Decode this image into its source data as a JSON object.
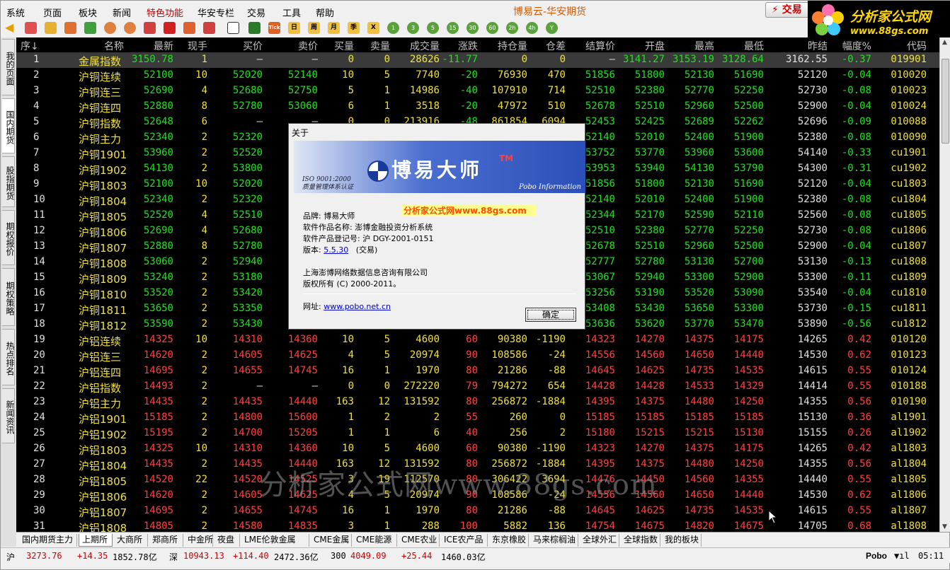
{
  "menu": [
    "系统",
    "页面",
    "板块",
    "新闻",
    "特色功能",
    "华安专栏",
    "交易",
    "工具",
    "帮助"
  ],
  "menu_highlight_index": 4,
  "title": "博易云-华安期货",
  "trade_button": "交易",
  "logo": {
    "name": "分析家公式网",
    "url": "www.88gs.com"
  },
  "toolbar_letters": [
    "日",
    "周",
    "月",
    "季",
    "X"
  ],
  "toolbar_circles": [
    "1",
    "3",
    "5",
    "15",
    "30",
    "60",
    "2h",
    "4h",
    "Y"
  ],
  "toolbar_tick": "Tick",
  "sidebar_tabs": [
    "我的页面",
    "国内期货",
    "股指期货",
    "期权报价",
    "期权策略",
    "热点排名",
    "新闻资讯"
  ],
  "sidebar_active": 1,
  "columns": [
    "序↓",
    "名称",
    "最新",
    "现手",
    "买价",
    "卖价",
    "买量",
    "卖量",
    "成交量",
    "涨跌",
    "持仓量",
    "仓差",
    "结算价",
    "开盘",
    "最高",
    "最低",
    "昨结",
    "幅度%",
    "代码"
  ],
  "rows": [
    [
      "1",
      "金属指数",
      "3150.78",
      "1",
      "—",
      "—",
      "0",
      "0",
      "28626",
      "-11.77",
      "0",
      "0",
      "—",
      "3141.27",
      "3153.19",
      "3128.64",
      "3162.55",
      "-0.37",
      "019901"
    ],
    [
      "2",
      "沪铜连续",
      "52100",
      "10",
      "52020",
      "52140",
      "10",
      "5",
      "7740",
      "-20",
      "76930",
      "470",
      "51856",
      "51800",
      "52130",
      "51690",
      "52120",
      "-0.04",
      "010020"
    ],
    [
      "3",
      "沪铜连三",
      "52690",
      "4",
      "52680",
      "52750",
      "5",
      "1",
      "14986",
      "-40",
      "107910",
      "714",
      "52510",
      "52380",
      "52770",
      "52250",
      "52730",
      "-0.08",
      "010023"
    ],
    [
      "4",
      "沪铜连四",
      "52880",
      "8",
      "52780",
      "53060",
      "6",
      "1",
      "3518",
      "-20",
      "47972",
      "510",
      "52678",
      "52510",
      "52960",
      "52500",
      "52900",
      "-0.04",
      "010024"
    ],
    [
      "5",
      "沪铜指数",
      "52648",
      "6",
      "—",
      "—",
      "0",
      "0",
      "213916",
      "-48",
      "861854",
      "6094",
      "52453",
      "52425",
      "52689",
      "52262",
      "52696",
      "-0.09",
      "010088"
    ],
    [
      "6",
      "沪铜主力",
      "52340",
      "2",
      "52320",
      "52340",
      "",
      "",
      "",
      "",
      "",
      "",
      "52140",
      "52010",
      "52400",
      "51900",
      "52380",
      "-0.08",
      "010090"
    ],
    [
      "7",
      "沪铜1901",
      "53960",
      "2",
      "52520",
      "",
      "",
      "",
      "",
      "",
      "",
      "",
      "53752",
      "53770",
      "53960",
      "53600",
      "54140",
      "-0.33",
      "cu1901"
    ],
    [
      "8",
      "沪铜1902",
      "54130",
      "2",
      "53800",
      "",
      "",
      "",
      "",
      "",
      "",
      "",
      "53953",
      "53940",
      "54130",
      "53790",
      "54300",
      "-0.31",
      "cu1902"
    ],
    [
      "9",
      "沪铜1803",
      "52100",
      "10",
      "52020",
      "",
      "",
      "",
      "",
      "",
      "",
      "",
      "51856",
      "51800",
      "52130",
      "51690",
      "52120",
      "-0.04",
      "cu1803"
    ],
    [
      "10",
      "沪铜1804",
      "52340",
      "2",
      "52320",
      "",
      "",
      "",
      "",
      "",
      "",
      "",
      "52140",
      "52010",
      "52400",
      "51900",
      "52380",
      "-0.08",
      "cu1804"
    ],
    [
      "11",
      "沪铜1805",
      "52520",
      "4",
      "52510",
      "",
      "",
      "",
      "",
      "",
      "",
      "",
      "52344",
      "52170",
      "52590",
      "52110",
      "52560",
      "-0.08",
      "cu1805"
    ],
    [
      "12",
      "沪铜1806",
      "52690",
      "4",
      "52680",
      "",
      "",
      "",
      "",
      "",
      "",
      "",
      "52510",
      "52380",
      "52770",
      "52250",
      "52730",
      "-0.08",
      "cu1806"
    ],
    [
      "13",
      "沪铜1807",
      "52880",
      "8",
      "52780",
      "",
      "",
      "",
      "",
      "",
      "",
      "",
      "52678",
      "52510",
      "52960",
      "52500",
      "52900",
      "-0.04",
      "cu1807"
    ],
    [
      "14",
      "沪铜1808",
      "53060",
      "2",
      "52940",
      "",
      "",
      "",
      "",
      "",
      "",
      "",
      "52777",
      "52780",
      "53130",
      "52700",
      "53130",
      "-0.13",
      "cu1808"
    ],
    [
      "15",
      "沪铜1809",
      "53240",
      "2",
      "53180",
      "",
      "",
      "",
      "",
      "",
      "",
      "",
      "53067",
      "52940",
      "53300",
      "52900",
      "53300",
      "-0.11",
      "cu1809"
    ],
    [
      "16",
      "沪铜1810",
      "53520",
      "2",
      "53420",
      "",
      "",
      "",
      "",
      "",
      "",
      "",
      "53256",
      "53190",
      "53520",
      "53090",
      "53540",
      "-0.04",
      "cu1810"
    ],
    [
      "17",
      "沪铜1811",
      "53650",
      "2",
      "53350",
      "",
      "",
      "",
      "",
      "",
      "",
      "",
      "53408",
      "53430",
      "53650",
      "53300",
      "53730",
      "-0.15",
      "cu1811"
    ],
    [
      "18",
      "沪铜1812",
      "53590",
      "2",
      "53430",
      "",
      "",
      "",
      "",
      "",
      "",
      "",
      "53636",
      "53620",
      "53770",
      "53470",
      "53890",
      "-0.56",
      "cu1812"
    ],
    [
      "19",
      "沪铝连续",
      "14325",
      "10",
      "14310",
      "14360",
      "10",
      "5",
      "4600",
      "60",
      "90380",
      "-1190",
      "14323",
      "14270",
      "14375",
      "14175",
      "14265",
      "0.42",
      "010120"
    ],
    [
      "20",
      "沪铝连三",
      "14620",
      "2",
      "14605",
      "14625",
      "4",
      "5",
      "20974",
      "90",
      "108586",
      "-24",
      "14556",
      "14560",
      "14650",
      "14440",
      "14530",
      "0.62",
      "010123"
    ],
    [
      "21",
      "沪铝连四",
      "14695",
      "2",
      "14655",
      "14745",
      "16",
      "1",
      "1970",
      "80",
      "21286",
      "-88",
      "14645",
      "14625",
      "14735",
      "14535",
      "14615",
      "0.55",
      "010124"
    ],
    [
      "22",
      "沪铝指数",
      "14493",
      "2",
      "—",
      "—",
      "0",
      "0",
      "272220",
      "79",
      "794272",
      "654",
      "14428",
      "14428",
      "14533",
      "14329",
      "14414",
      "0.55",
      "010188"
    ],
    [
      "23",
      "沪铝主力",
      "14435",
      "2",
      "14435",
      "14440",
      "163",
      "12",
      "131592",
      "80",
      "256872",
      "-1884",
      "14395",
      "14375",
      "14480",
      "14250",
      "14355",
      "0.56",
      "010190"
    ],
    [
      "24",
      "沪铝1901",
      "15185",
      "2",
      "14800",
      "15600",
      "1",
      "2",
      "2",
      "55",
      "260",
      "0",
      "15185",
      "15185",
      "15185",
      "15185",
      "15130",
      "0.36",
      "al1901"
    ],
    [
      "25",
      "沪铝1902",
      "15195",
      "2",
      "14700",
      "15205",
      "1",
      "1",
      "6",
      "40",
      "256",
      "2",
      "15180",
      "15215",
      "15215",
      "15130",
      "15155",
      "0.26",
      "al1902"
    ],
    [
      "26",
      "沪铝1803",
      "14325",
      "10",
      "14310",
      "14360",
      "10",
      "5",
      "4600",
      "60",
      "90380",
      "-1190",
      "14323",
      "14270",
      "14375",
      "14175",
      "14265",
      "0.42",
      "al1803"
    ],
    [
      "27",
      "沪铝1804",
      "14435",
      "2",
      "14435",
      "14440",
      "163",
      "12",
      "131592",
      "80",
      "256872",
      "-1884",
      "14395",
      "14375",
      "14480",
      "14250",
      "14355",
      "0.56",
      "al1804"
    ],
    [
      "28",
      "沪铝1805",
      "14520",
      "22",
      "14520",
      "14525",
      "3",
      "19",
      "112570",
      "80",
      "306422",
      "3694",
      "14476",
      "14450",
      "14560",
      "14355",
      "14440",
      "0.55",
      "al1805"
    ],
    [
      "29",
      "沪铝1806",
      "14620",
      "2",
      "14605",
      "14625",
      "4",
      "5",
      "20974",
      "90",
      "108586",
      "-24",
      "14556",
      "14560",
      "14650",
      "14440",
      "14530",
      "0.62",
      "al1806"
    ],
    [
      "30",
      "沪铝1807",
      "14695",
      "2",
      "14655",
      "14745",
      "16",
      "1",
      "1970",
      "80",
      "21286",
      "-88",
      "14645",
      "14625",
      "14735",
      "14535",
      "14615",
      "0.55",
      "al1807"
    ],
    [
      "31",
      "沪铝1808",
      "14805",
      "2",
      "14580",
      "14835",
      "3",
      "1",
      "288",
      "100",
      "5882",
      "136",
      "14754",
      "14675",
      "14820",
      "14675",
      "14705",
      "0.68",
      "al1808"
    ]
  ],
  "exchange_tabs": [
    "国内期货主力",
    "上期所",
    "大商所",
    "郑商所",
    "中金所",
    "夜盘",
    "LME伦敦金属",
    "CME金属",
    "CME能源",
    "CME农业",
    "ICE农产品",
    "东京橡胶",
    "马来棕榈油",
    "全球外汇",
    "全球指数",
    "我的板块"
  ],
  "exchange_active": 1,
  "status": {
    "sh_label": "沪",
    "sh_value": "3273.76",
    "sh_change": "+14.35",
    "sh_amount": "1852.78亿",
    "sz_label": "深",
    "sz_value": "10943.13",
    "sz_change": "+114.40",
    "sz_amount": "2472.36亿",
    "hs_label": "300",
    "hs_value": "4049.09",
    "hs_change": "+25.44",
    "hs_amount": "1460.03亿",
    "brand": "Pobo",
    "time": "05:11"
  },
  "watermark": "分析家公式网www.88gs.com",
  "dialog": {
    "title": "关于",
    "banner_name": "博易大师",
    "banner_tm": "TM",
    "banner_iso": "ISO 9001:2000",
    "banner_iso2": "质量管理体系认证",
    "banner_pobo": "Pobo Information",
    "watermark": "分析家公式网www.88gs.com",
    "brand_line": "品牌: 博易大师",
    "product_line": "软件作品名称: 澎博金融投资分析系统",
    "reg_line": "软件产品登记号: 沪 DGY-2001-0151",
    "version_label": "版本:",
    "version": "5.5.30",
    "version_suffix": "(交易)",
    "company": "上海澎博网络数据信息咨询有限公司",
    "copyright": "版权所有 (C) 2000-2011。",
    "site_label": "网址:",
    "site": "www.pobo.net.cn",
    "ok": "确定"
  },
  "colors": {
    "up": "#ff4040",
    "down": "#20e020",
    "name": "#f0e040",
    "bg": "#000000"
  }
}
